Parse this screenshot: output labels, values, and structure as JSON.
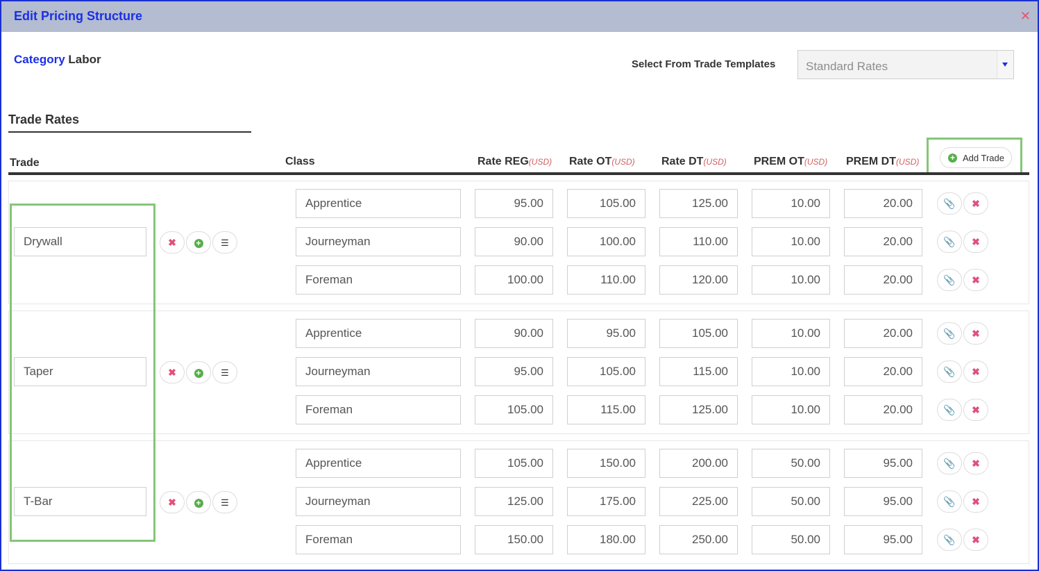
{
  "dialog": {
    "title": "Edit Pricing Structure",
    "close_glyph": "✕"
  },
  "category": {
    "label": "Category",
    "value": "Labor"
  },
  "template": {
    "label": "Select From Trade Templates",
    "selected": "Standard Rates"
  },
  "section": {
    "title": "Trade Rates"
  },
  "columns": {
    "trade": "Trade",
    "class": "Class",
    "rate_reg": "Rate REG",
    "rate_ot": "Rate OT",
    "rate_dt": "Rate DT",
    "prem_ot": "PREM OT",
    "prem_dt": "PREM DT",
    "unit": "(USD)"
  },
  "add_trade_label": "Add Trade",
  "icons": {
    "remove": "✖",
    "add": "+",
    "list": "☰",
    "edit": "📎"
  },
  "colors": {
    "title_blue": "#1a2fe6",
    "titlebar": "#b3bcd1",
    "highlight_green": "#84c676",
    "remove_red": "#e2507a",
    "add_green": "#56b04a",
    "unit_red": "#d0605e"
  },
  "trades": [
    {
      "name": "Drywall",
      "rows": [
        {
          "class": "Apprentice",
          "reg": "95.00",
          "ot": "105.00",
          "dt": "125.00",
          "prem_ot": "10.00",
          "prem_dt": "20.00"
        },
        {
          "class": "Journeyman",
          "reg": "90.00",
          "ot": "100.00",
          "dt": "110.00",
          "prem_ot": "10.00",
          "prem_dt": "20.00"
        },
        {
          "class": "Foreman",
          "reg": "100.00",
          "ot": "110.00",
          "dt": "120.00",
          "prem_ot": "10.00",
          "prem_dt": "20.00"
        }
      ]
    },
    {
      "name": "Taper",
      "rows": [
        {
          "class": "Apprentice",
          "reg": "90.00",
          "ot": "95.00",
          "dt": "105.00",
          "prem_ot": "10.00",
          "prem_dt": "20.00"
        },
        {
          "class": "Journeyman",
          "reg": "95.00",
          "ot": "105.00",
          "dt": "115.00",
          "prem_ot": "10.00",
          "prem_dt": "20.00"
        },
        {
          "class": "Foreman",
          "reg": "105.00",
          "ot": "115.00",
          "dt": "125.00",
          "prem_ot": "10.00",
          "prem_dt": "20.00"
        }
      ]
    },
    {
      "name": "T-Bar",
      "rows": [
        {
          "class": "Apprentice",
          "reg": "105.00",
          "ot": "150.00",
          "dt": "200.00",
          "prem_ot": "50.00",
          "prem_dt": "95.00"
        },
        {
          "class": "Journeyman",
          "reg": "125.00",
          "ot": "175.00",
          "dt": "225.00",
          "prem_ot": "50.00",
          "prem_dt": "95.00"
        },
        {
          "class": "Foreman",
          "reg": "150.00",
          "ot": "180.00",
          "dt": "250.00",
          "prem_ot": "50.00",
          "prem_dt": "95.00"
        }
      ]
    }
  ]
}
